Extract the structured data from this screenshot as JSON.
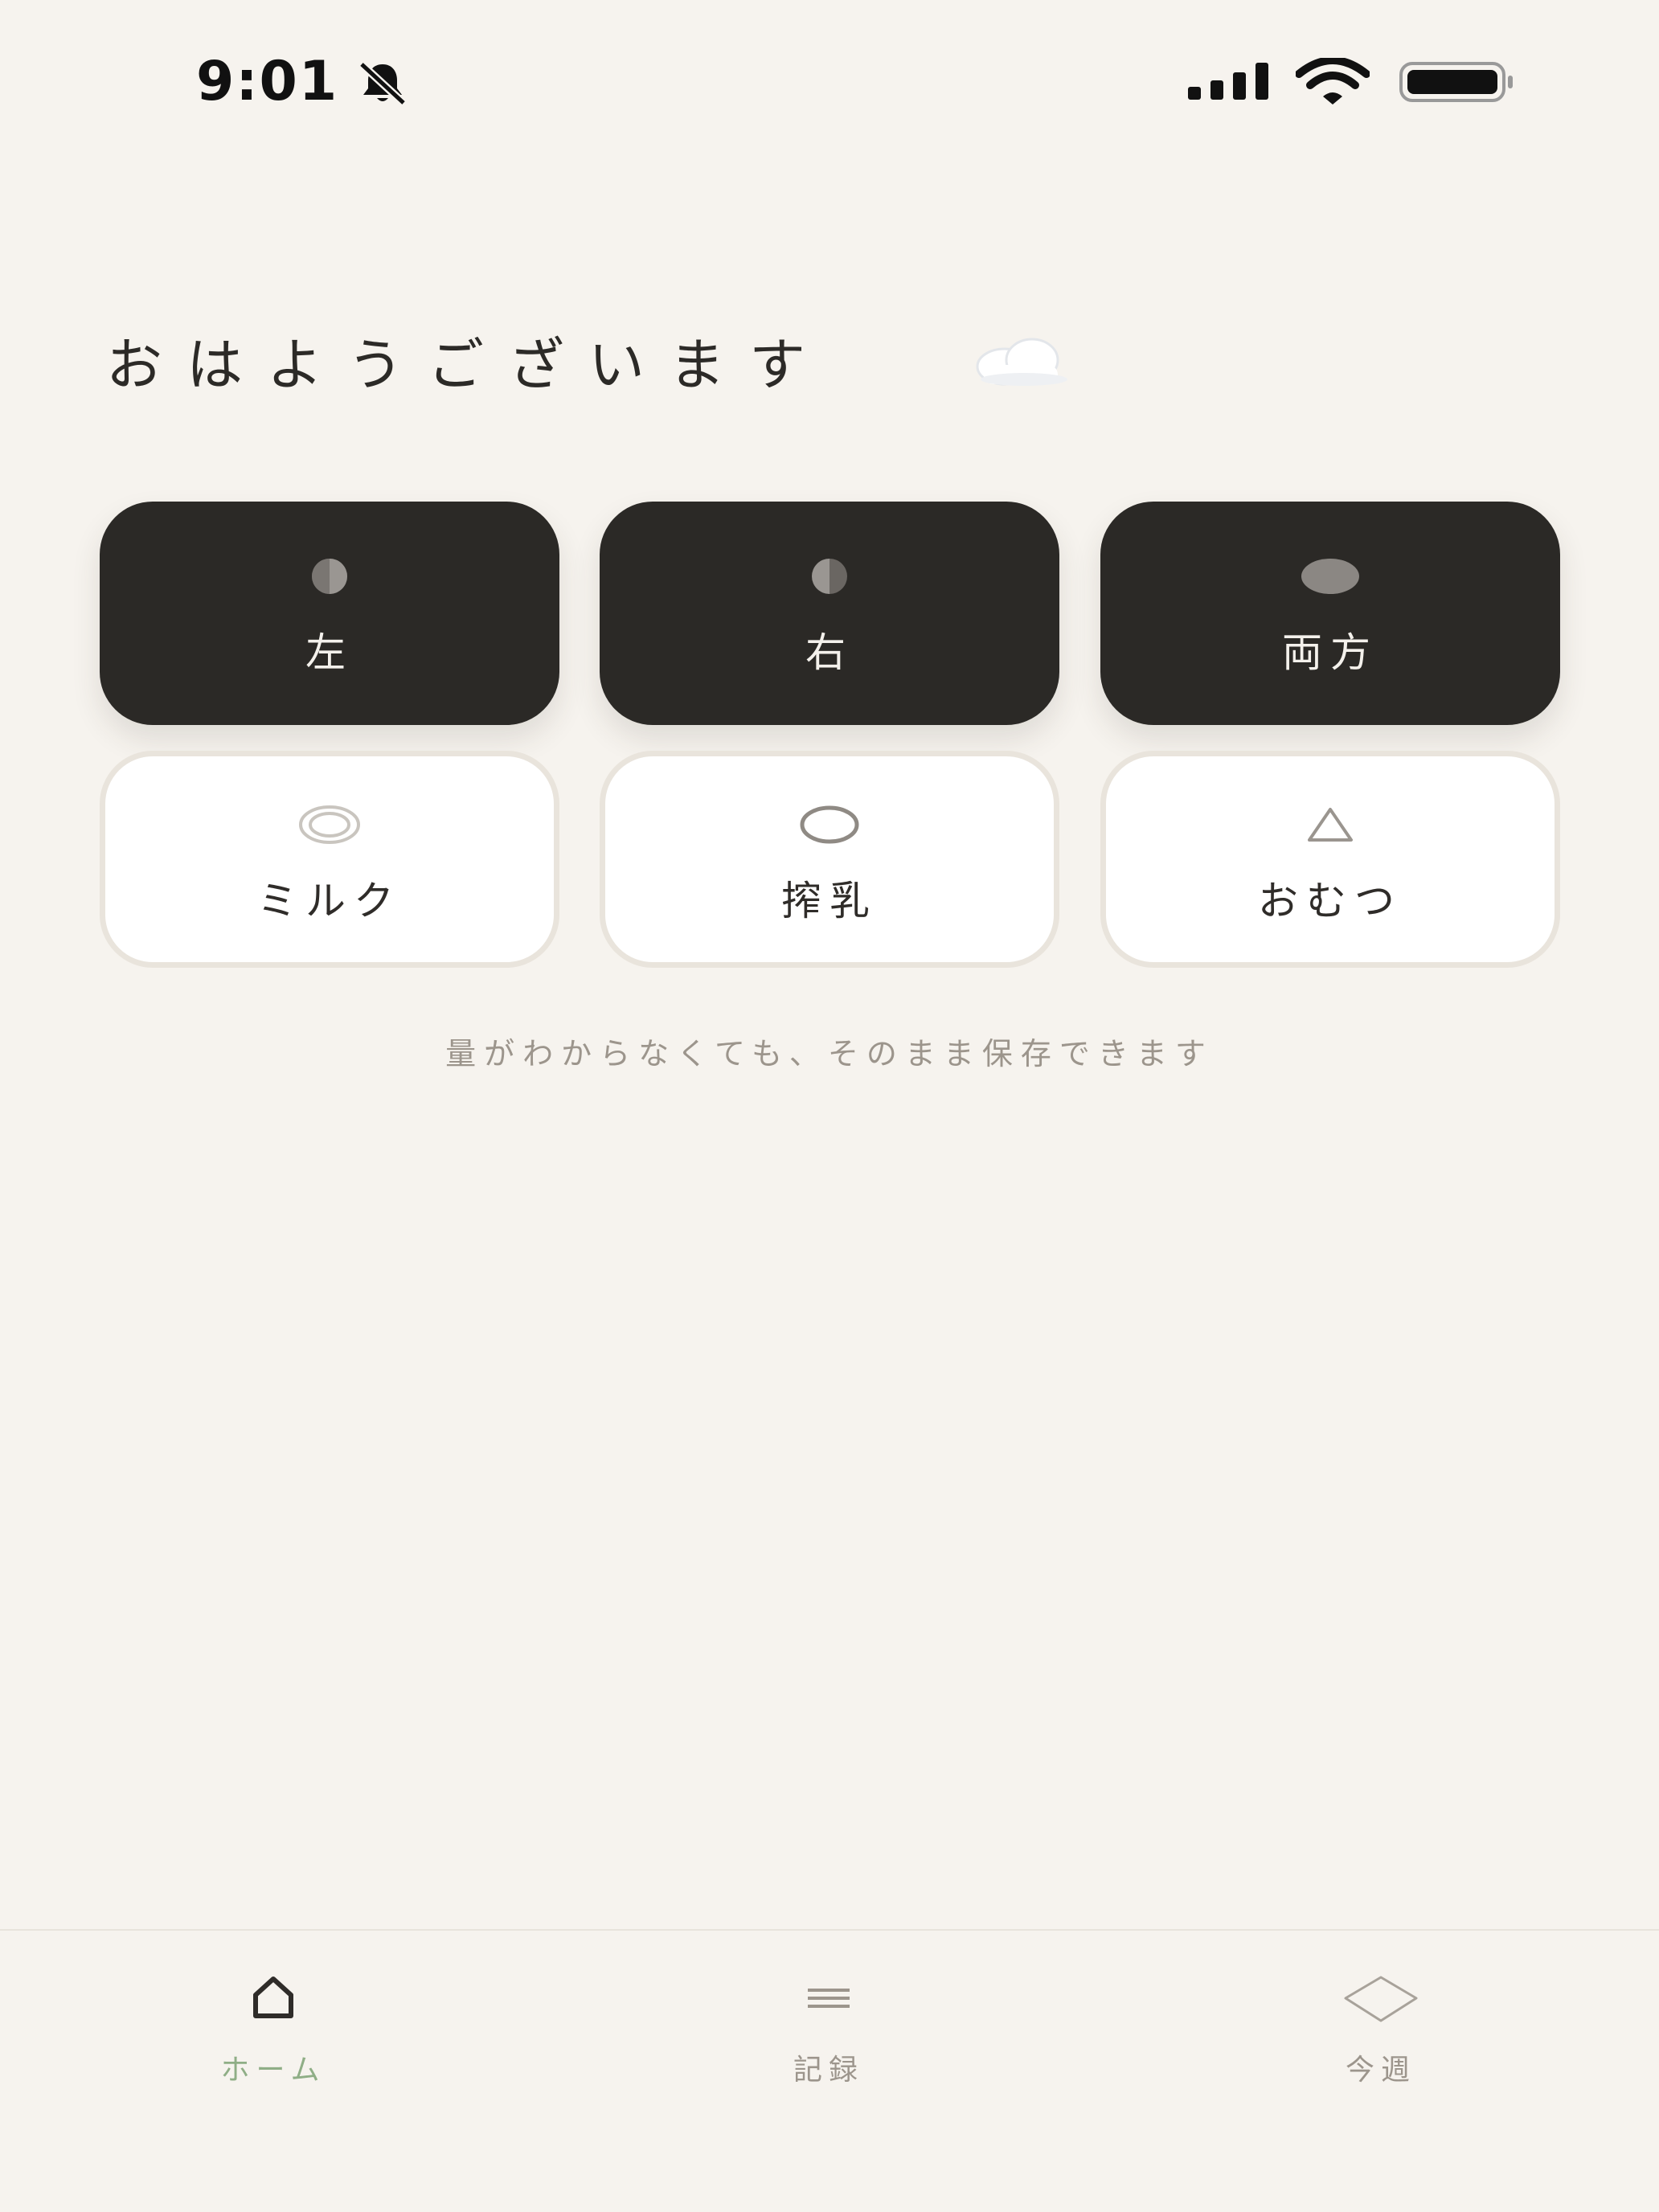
{
  "status_bar": {
    "time": "9:01"
  },
  "greeting": {
    "text": "おはようございます",
    "weather_icon": "cloud-icon"
  },
  "feeding_buttons": [
    {
      "label": "左",
      "icon": "half-circle-left-icon"
    },
    {
      "label": "右",
      "icon": "half-circle-right-icon"
    },
    {
      "label": "両方",
      "icon": "filled-circle-icon"
    }
  ],
  "other_buttons": [
    {
      "label": "ミルク",
      "icon": "double-circle-icon"
    },
    {
      "label": "搾乳",
      "icon": "circle-icon"
    },
    {
      "label": "おむつ",
      "icon": "triangle-icon"
    }
  ],
  "helper_text": "量がわからなくても、そのまま保存できます",
  "tabs": [
    {
      "label": "ホーム",
      "icon": "home-icon",
      "active": true
    },
    {
      "label": "記録",
      "icon": "list-icon",
      "active": false
    },
    {
      "label": "今週",
      "icon": "diamond-icon",
      "active": false
    }
  ],
  "colors": {
    "background": "#f6f3ee",
    "dark_button": "#2b2926",
    "active_tab": "#8fae86",
    "inactive_tab": "#9c958c"
  }
}
